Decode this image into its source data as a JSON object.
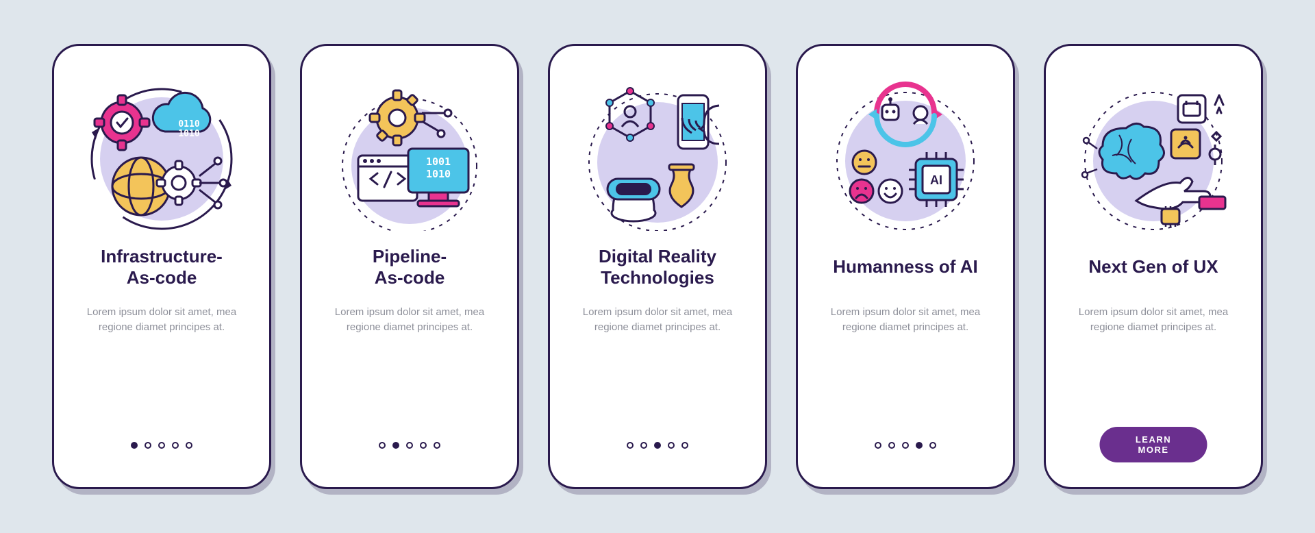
{
  "screens": [
    {
      "title": "Infrastructure-\nAs-code",
      "description": "Lorem ipsum dolor sit amet, mea regione diamet principes at.",
      "active_dot": 0,
      "icon": "infrastructure-as-code-icon"
    },
    {
      "title": "Pipeline-\nAs-code",
      "description": "Lorem ipsum dolor sit amet, mea regione diamet principes at.",
      "active_dot": 1,
      "icon": "pipeline-as-code-icon"
    },
    {
      "title": "Digital Reality\nTechnologies",
      "description": "Lorem ipsum dolor sit amet, mea regione diamet principes at.",
      "active_dot": 2,
      "icon": "digital-reality-icon"
    },
    {
      "title": "Humanness of AI",
      "description": "Lorem ipsum dolor sit amet, mea regione diamet principes at.",
      "active_dot": 3,
      "icon": "humanness-ai-icon"
    },
    {
      "title": "Next Gen of UX",
      "description": "Lorem ipsum dolor sit amet, mea regione diamet principes at.",
      "active_dot": 4,
      "icon": "next-gen-ux-icon",
      "cta_label": "LEARN MORE"
    }
  ],
  "dot_count": 5,
  "colors": {
    "background": "#dfe6ec",
    "card": "#ffffff",
    "stroke": "#2a1a4d",
    "title": "#2a1a4d",
    "muted": "#8d8f99",
    "purple_soft": "#d6d0f0",
    "cyan": "#4cc4e8",
    "pink": "#e8338f",
    "yellow": "#f3c45a",
    "violet": "#5e3fa8",
    "button": "#6a2f8e"
  }
}
